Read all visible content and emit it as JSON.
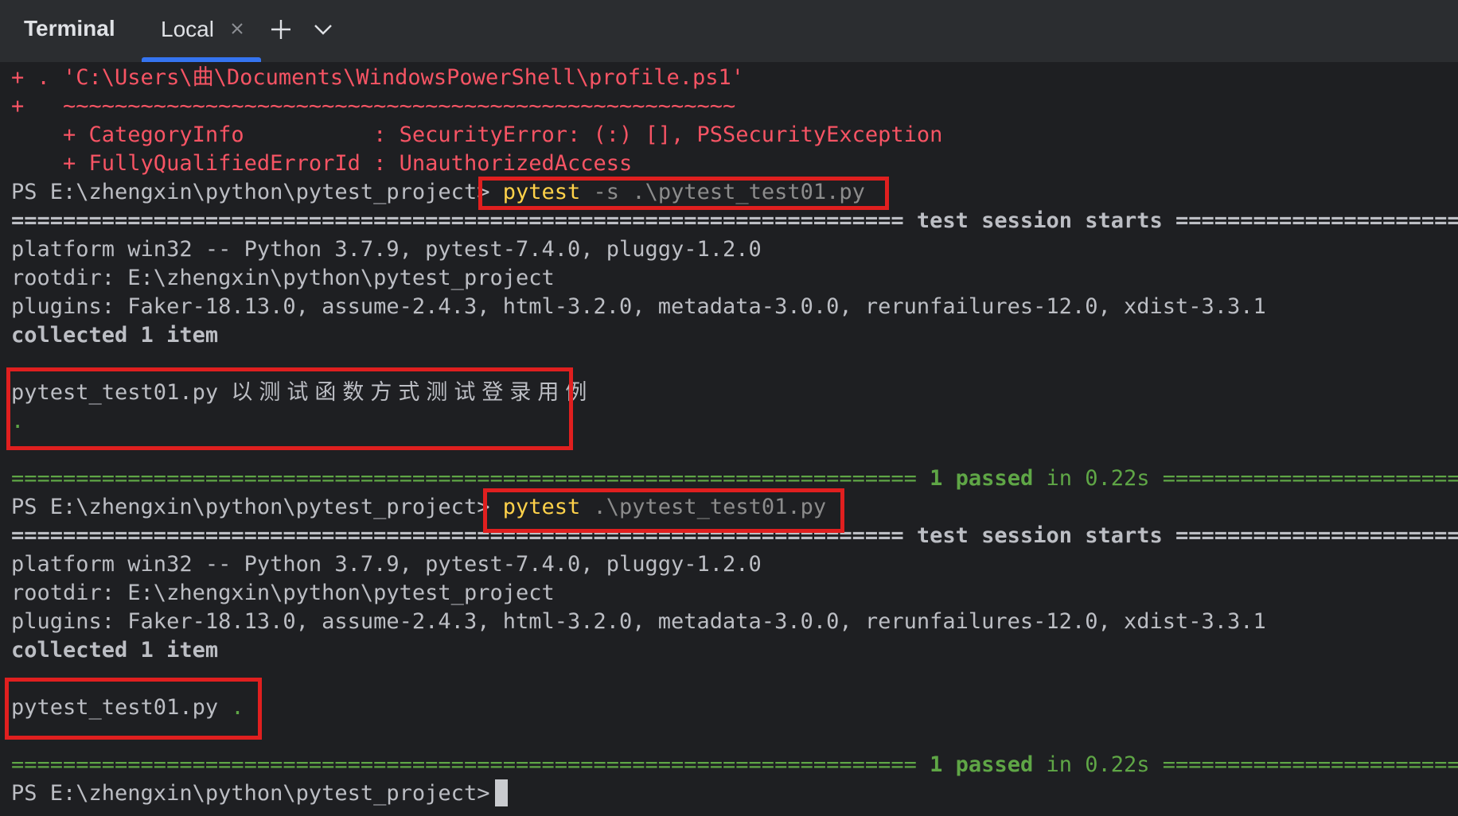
{
  "toolbar": {
    "title": "Terminal",
    "tab_label": "Local",
    "close_icon": "close-icon",
    "add_icon": "plus-icon",
    "dropdown_icon": "chevron-down-icon"
  },
  "colors": {
    "error": "#f75464",
    "command": "#ffd24a",
    "pass": "#5fa646",
    "highlight_box": "#e01f1f",
    "tab_accent": "#3574f0"
  },
  "terminal": {
    "lines": [
      "+ . 'C:\\Users\\曲\\Documents\\WindowsPowerShell\\profile.ps1'",
      "+   ~~~~~~~~~~~~~~~~~~~~~~~~~~~~~~~~~~~~~~~~~~~~~~~~~~~~",
      "    + CategoryInfo          : SecurityError: (:) [], PSSecurityException",
      "    + FullyQualifiedErrorId : UnauthorizedAccess"
    ],
    "prompt": "PS E:\\zhengxin\\python\\pytest_project>",
    "run1": {
      "cmd": "pytest",
      "flag": "-s",
      "arg": ".\\pytest_test01.py",
      "session_rule_left": "=====================================================================",
      "session_text": "test session starts",
      "session_rule_right": "=========================",
      "platform": "platform win32 -- Python 3.7.9, pytest-7.4.0, pluggy-1.2.0",
      "rootdir": "rootdir: E:\\zhengxin\\python\\pytest_project",
      "plugins": "plugins: Faker-18.13.0, assume-2.4.3, html-3.2.0, metadata-3.0.0, rerunfailures-12.0, xdist-3.3.1",
      "collected": "collected 1 item",
      "file": "pytest_test01.py",
      "print_output": "以测试函数方式测试登录用例",
      "dot": ".",
      "result_rule_left": "======================================================================",
      "result_passed": "1 passed",
      "result_time": "in 0.22s",
      "result_rule_right": "========================="
    },
    "run2": {
      "cmd": "pytest",
      "arg": ".\\pytest_test01.py",
      "session_rule_left": "=====================================================================",
      "session_text": "test session starts",
      "session_rule_right": "=========================",
      "platform": "platform win32 -- Python 3.7.9, pytest-7.4.0, pluggy-1.2.0",
      "rootdir": "rootdir: E:\\zhengxin\\python\\pytest_project",
      "plugins": "plugins: Faker-18.13.0, assume-2.4.3, html-3.2.0, metadata-3.0.0, rerunfailures-12.0, xdist-3.3.1",
      "collected": "collected 1 item",
      "file": "pytest_test01.py",
      "dot": ".",
      "result_rule_left": "======================================================================",
      "result_passed": "1 passed",
      "result_time": "in 0.22s",
      "result_rule_right": "========================="
    }
  }
}
